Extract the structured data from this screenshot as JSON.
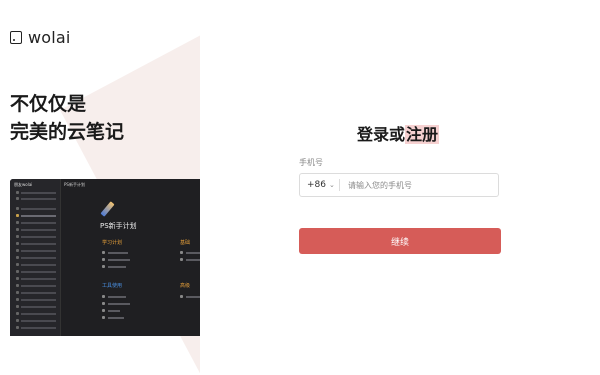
{
  "brand": {
    "logo_text": "wolai"
  },
  "slogan": {
    "line1": "不仅仅是",
    "line2": "完美的云笔记"
  },
  "mock_app": {
    "workspace": "朋友wolai",
    "breadcrumb": "PS新手计划",
    "page_title": "PS新手计划",
    "section_learning": "学习计划",
    "section_basic": "基础",
    "section_tools": "工具使用",
    "section_advanced": "高级"
  },
  "login": {
    "title_plain": "登录或",
    "title_highlight": "注册",
    "phone_label": "手机号",
    "country_code": "+86",
    "phone_placeholder": "请输入您的手机号",
    "continue_label": "继续"
  },
  "colors": {
    "primary": "#d65c58",
    "highlight": "#f6d1d1",
    "accent_bg": "#f7eeec"
  },
  "icons": {
    "logo": "wolai-logo-icon",
    "chevron": "chevron-down-icon"
  }
}
